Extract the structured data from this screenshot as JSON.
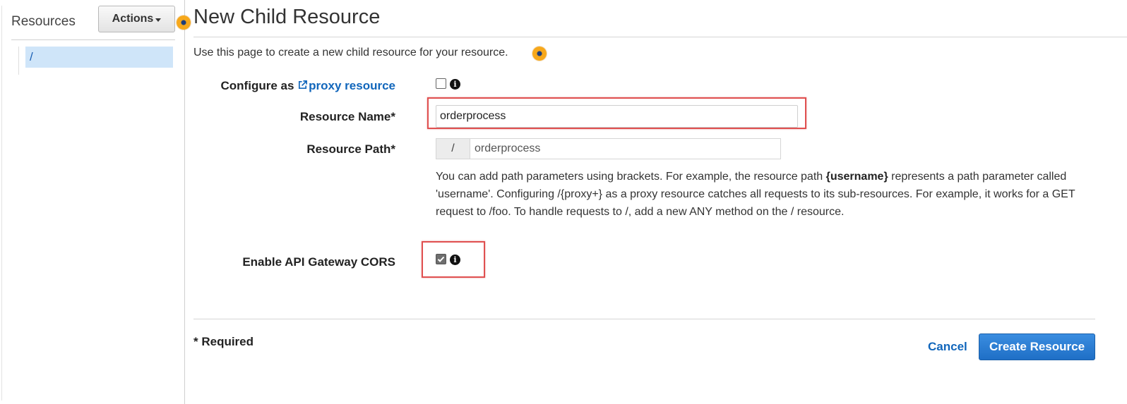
{
  "sidebar": {
    "title": "Resources",
    "actions_label": "Actions",
    "tree_root": "/"
  },
  "form": {
    "title": "New Child Resource",
    "intro": "Use this page to create a new child resource for your resource.",
    "proxy": {
      "label_prefix": "Configure as",
      "link_text": "proxy resource",
      "checked": false
    },
    "resource_name": {
      "label": "Resource Name*",
      "value": "orderprocess"
    },
    "resource_path": {
      "label": "Resource Path*",
      "prefix": "/",
      "value": "orderprocess"
    },
    "help": {
      "part1": "You can add path parameters using brackets. For example, the resource path ",
      "bold": "{username}",
      "part2": " represents a path parameter called 'username'. Configuring /{proxy+} as a proxy resource catches all requests to its sub-resources. For example, it works for a GET request to /foo. To handle requests to /, add a new ANY method on the / resource."
    },
    "cors": {
      "label": "Enable API Gateway CORS",
      "checked": true
    },
    "info_glyph": "i",
    "required_note": "* Required",
    "cancel_label": "Cancel",
    "create_label": "Create Resource"
  },
  "colors": {
    "link": "#1166bb",
    "primary_button": "#1f6fc6",
    "highlight": "#e05050",
    "selected_row": "#cfe5f9",
    "hotspot": "#f7a81b"
  },
  "icons": {
    "external_link": "external-link-icon",
    "info": "info-icon",
    "caret": "caret-down-icon",
    "hotspot": "hotspot-marker-icon"
  }
}
